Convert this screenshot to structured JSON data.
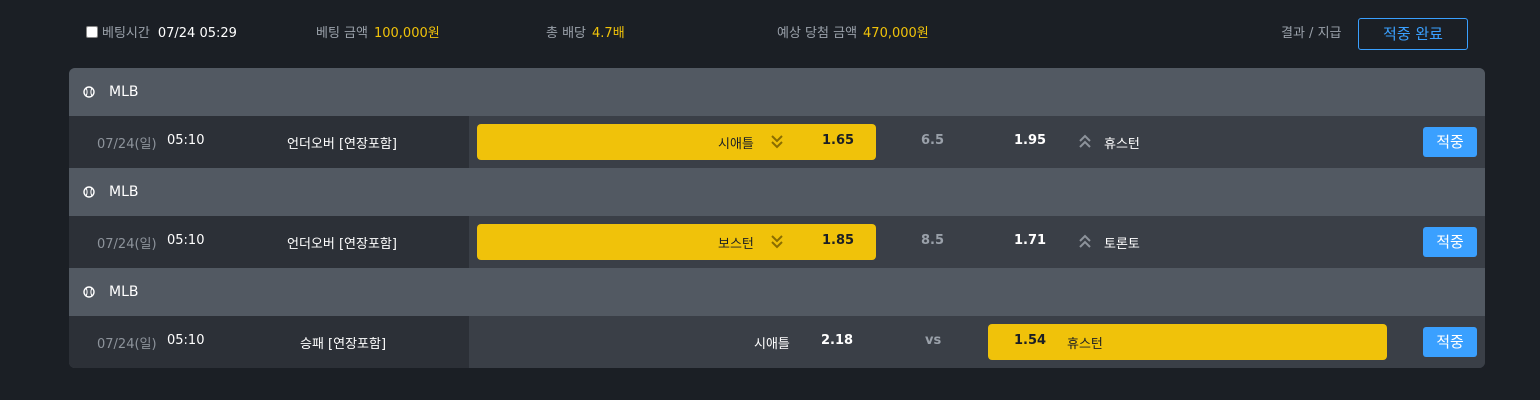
{
  "header": {
    "bet_time_label": "베팅시간",
    "bet_time_value": "07/24 05:29",
    "bet_amount_label": "베팅 금액",
    "bet_amount_value": "100,000원",
    "total_odds_label": "총 배당",
    "total_odds_value": "4.7배",
    "expected_label": "예상 당첨 금액",
    "expected_value": "470,000원",
    "result_label": "결과 / 지급",
    "status_button": "적중 완료"
  },
  "colors": {
    "accent_blue": "#3aa0ff",
    "pick_yellow": "#f0c20a",
    "league_bar": "#525962",
    "row_bg": "#3a3f47"
  },
  "bets": [
    {
      "league": "MLB",
      "date": "07/24(일)",
      "time": "05:10",
      "market": "언더오버 [연장포함]",
      "home_team": "시애틀",
      "home_odds": "1.65",
      "line": "6.5",
      "away_odds": "1.95",
      "away_team": "휴스턴",
      "result": "적중",
      "selected": "under"
    },
    {
      "league": "MLB",
      "date": "07/24(일)",
      "time": "05:10",
      "market": "언더오버 [연장포함]",
      "home_team": "보스턴",
      "home_odds": "1.85",
      "line": "8.5",
      "away_odds": "1.71",
      "away_team": "토론토",
      "result": "적중",
      "selected": "under"
    },
    {
      "league": "MLB",
      "date": "07/24(일)",
      "time": "05:10",
      "market": "승패 [연장포함]",
      "home_team": "시애틀",
      "home_odds": "2.18",
      "line": "vs",
      "away_odds": "1.54",
      "away_team": "휴스턴",
      "result": "적중",
      "selected": "away"
    }
  ]
}
